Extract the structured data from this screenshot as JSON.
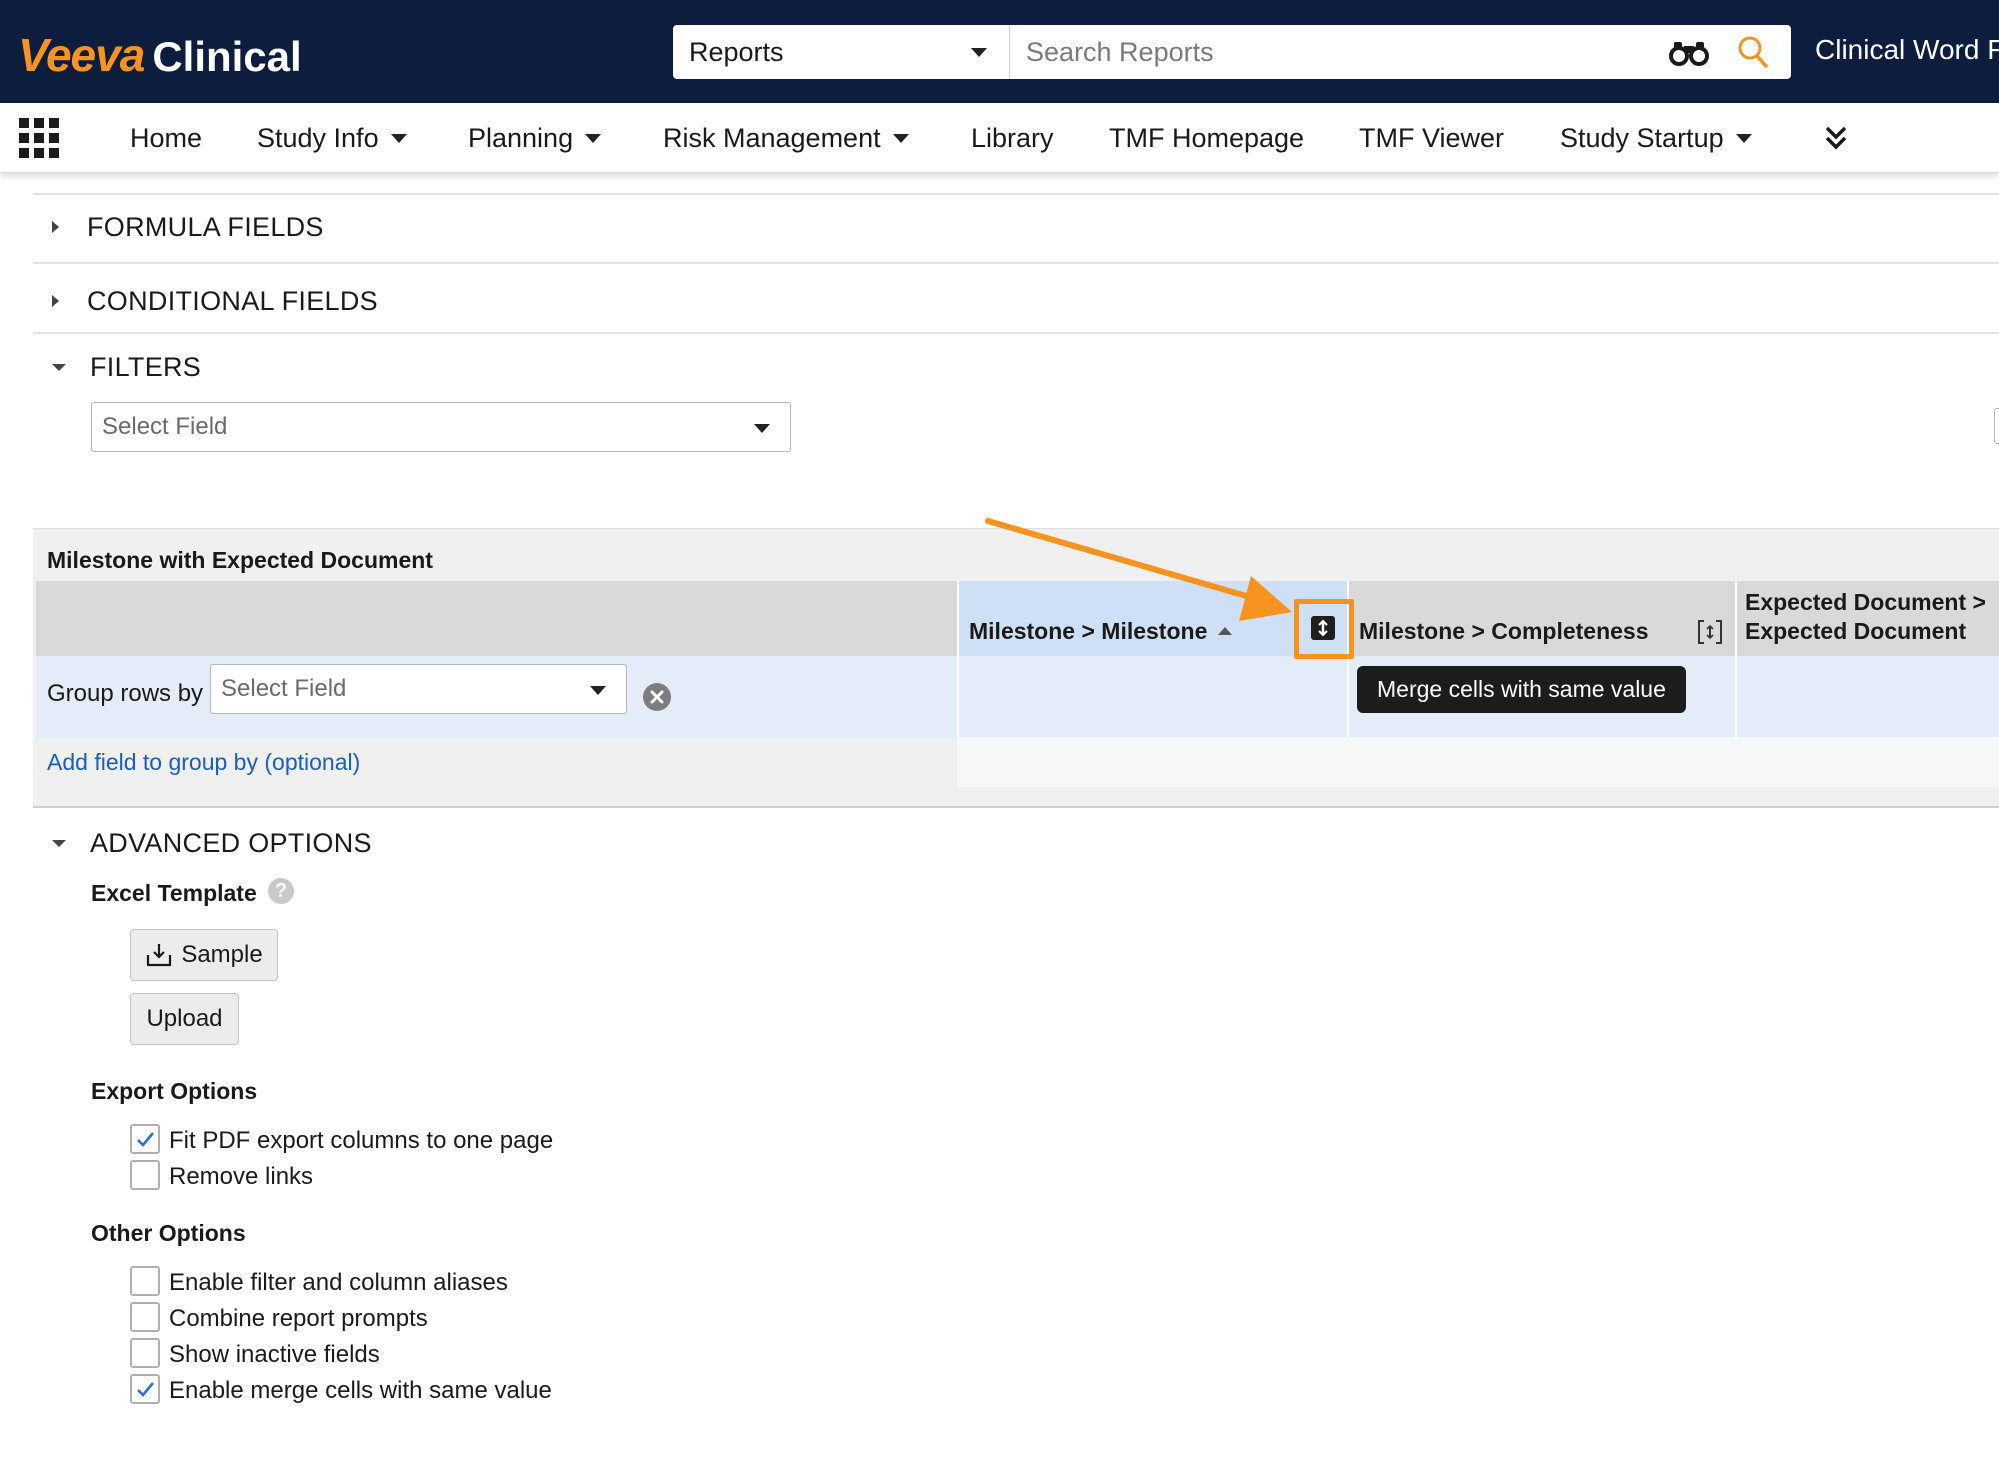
{
  "brand": {
    "logo_word": "Veeva",
    "logo_product": "Clinical",
    "accent_color": "#f7931e",
    "topbar_color": "#0c1d3d"
  },
  "search": {
    "scope": "Reports",
    "placeholder": "Search Reports"
  },
  "header": {
    "app_name": "Clinical Word F"
  },
  "nav": {
    "items": [
      {
        "label": "Home",
        "has_menu": false
      },
      {
        "label": "Study Info",
        "has_menu": true
      },
      {
        "label": "Planning",
        "has_menu": true
      },
      {
        "label": "Risk Management",
        "has_menu": true
      },
      {
        "label": "Library",
        "has_menu": false
      },
      {
        "label": "TMF Homepage",
        "has_menu": false
      },
      {
        "label": "TMF Viewer",
        "has_menu": false
      },
      {
        "label": "Study Startup",
        "has_menu": true
      }
    ],
    "more_icon": "double-chevron-down-icon"
  },
  "sections": {
    "formula_fields": "FORMULA FIELDS",
    "conditional_fields": "CONDITIONAL FIELDS",
    "filters": "FILTERS",
    "filters_select_placeholder": "Select Field",
    "advanced_options": "ADVANCED OPTIONS"
  },
  "report": {
    "title": "Milestone with Expected Document",
    "columns": [
      {
        "label": "Milestone > Milestone",
        "sorted": "ascending",
        "merge_cells": true
      },
      {
        "label": "Milestone > Completeness",
        "merge_cells": false
      },
      {
        "label_line1": "Expected Document >",
        "label_line2": "Expected Document"
      }
    ],
    "group_rows_label": "Group rows by",
    "group_select_placeholder": "Select Field",
    "add_group_link": "Add field to group by (optional)",
    "tooltip": "Merge cells with same value"
  },
  "advanced": {
    "excel_template_label": "Excel Template",
    "sample_button": "Sample",
    "upload_button": "Upload",
    "export_options_label": "Export Options",
    "export_options": [
      {
        "label": "Fit PDF export columns to one page",
        "checked": true
      },
      {
        "label": "Remove links",
        "checked": false
      }
    ],
    "other_options_label": "Other Options",
    "other_options": [
      {
        "label": "Enable filter and column aliases",
        "checked": false
      },
      {
        "label": "Combine report prompts",
        "checked": false
      },
      {
        "label": "Show inactive fields",
        "checked": false
      },
      {
        "label": "Enable merge cells with same value",
        "checked": true
      }
    ]
  }
}
